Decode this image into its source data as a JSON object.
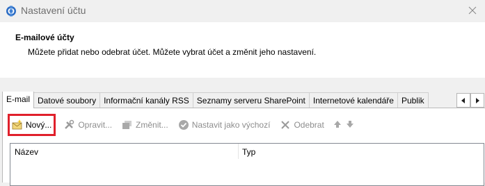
{
  "window": {
    "title": "Nastavení účtu",
    "icon": "outlook-app-icon",
    "close_icon": "close-icon"
  },
  "header": {
    "title": "E-mailové účty",
    "description": "Můžete přidat nebo odebrat účet. Můžete vybrat účet a změnit jeho nastavení."
  },
  "tabs": [
    {
      "label": "E-mail",
      "active": true
    },
    {
      "label": "Datové soubory",
      "active": false
    },
    {
      "label": "Informační kanály RSS",
      "active": false
    },
    {
      "label": "Seznamy serveru SharePoint",
      "active": false
    },
    {
      "label": "Internetové kalendáře",
      "active": false
    },
    {
      "label": "Publik",
      "active": false
    }
  ],
  "toolbar": {
    "new_label": "Nový...",
    "repair_label": "Opravit...",
    "change_label": "Změnit...",
    "set_default_label": "Nastavit jako výchozí",
    "remove_label": "Odebrat"
  },
  "list": {
    "columns": [
      "Název",
      "Typ"
    ]
  },
  "colors": {
    "highlight": "#e0202b",
    "disabled_text": "#8d8d8d"
  }
}
